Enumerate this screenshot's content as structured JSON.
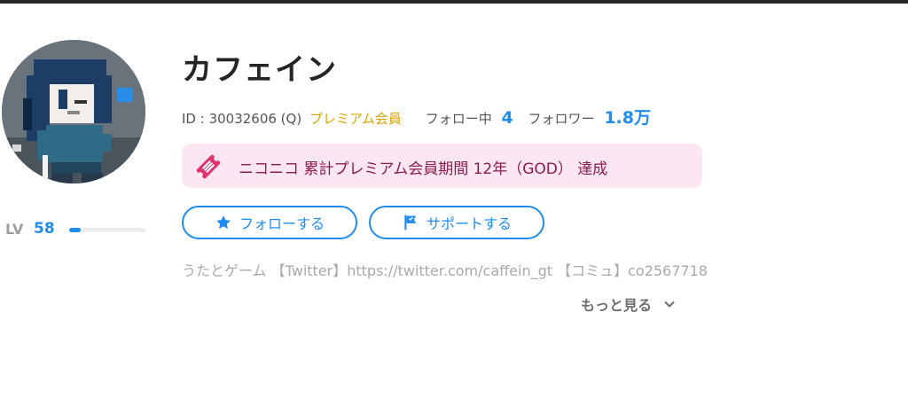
{
  "profile": {
    "name": "カフェイン",
    "id_text": "ID : 30032606 (Q)",
    "premium_label": "プレミアム会員",
    "following_label": "フォロー中",
    "following_count": "4",
    "followers_label": "フォロワー",
    "followers_count": "1.8万",
    "level_label": "LV",
    "level_value": "58",
    "level_progress": 0.15,
    "achievement": "ニコニコ 累計プレミアム会員期間 12年（GOD） 達成",
    "description": "うたとゲーム 【Twitter】https://twitter.com/caffein_gt 【コミュ】co2567718"
  },
  "actions": {
    "follow_label": "フォローする",
    "support_label": "サポートする",
    "more_label": "もっと見る"
  },
  "icons": {
    "follow": "star-icon",
    "support": "flag-icon",
    "more": "chevron-down-icon",
    "badge": "ticket-icon"
  },
  "colors": {
    "accent": "#1f8cf0",
    "premium": "#d9a300",
    "badge_bg": "#fbe6f1",
    "badge_text": "#8a1c4f",
    "badge_icon": "#e0336e"
  }
}
